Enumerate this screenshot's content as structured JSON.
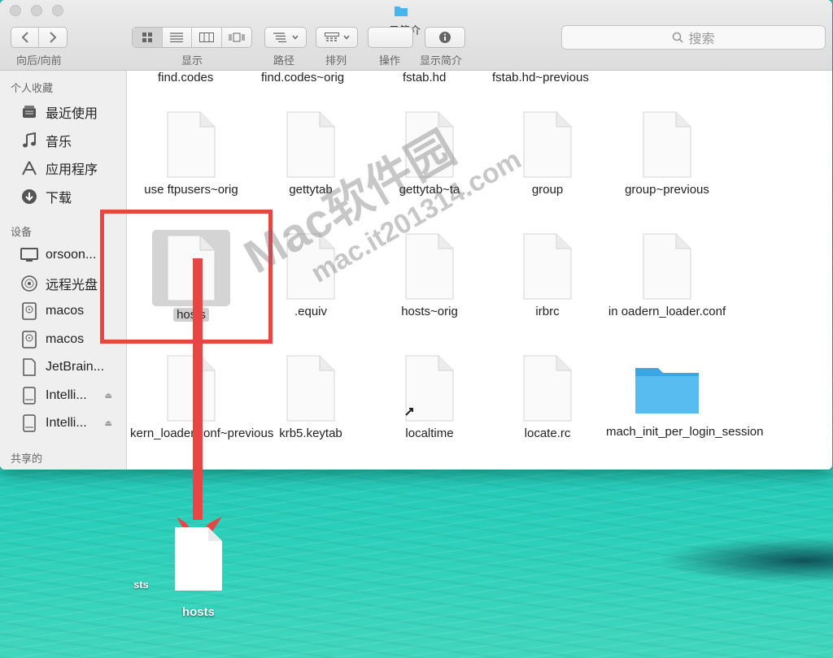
{
  "window": {
    "title": "示简介"
  },
  "toolbar": {
    "back_forward_label": "向后/向前",
    "view_label": "显示",
    "path_label": "路径",
    "arrange_label": "排列",
    "action_label": "操作",
    "info_label": "显示简介",
    "search_placeholder": "搜索"
  },
  "sidebar": {
    "favorites_header": "个人收藏",
    "favorites": [
      {
        "label": "最近使用",
        "icon": "recents-icon"
      },
      {
        "label": "音乐",
        "icon": "music-icon"
      },
      {
        "label": "应用程序",
        "icon": "applications-icon"
      },
      {
        "label": "下载",
        "icon": "downloads-icon"
      }
    ],
    "devices_header": "设备",
    "devices": [
      {
        "label": "orsoon...",
        "icon": "computer-icon"
      },
      {
        "label": "远程光盘",
        "icon": "disc-icon"
      },
      {
        "label": "macos",
        "icon": "disk-icon"
      },
      {
        "label": "macos",
        "icon": "disk-icon"
      },
      {
        "label": "JetBrain...",
        "icon": "document-icon"
      },
      {
        "label": "Intelli...",
        "icon": "external-disk-icon"
      },
      {
        "label": "Intelli...",
        "icon": "external-disk-icon"
      }
    ],
    "shared_header": "共享的"
  },
  "files": {
    "top_row": [
      "find.codes",
      "find.codes~orig",
      "fstab.hd",
      "fstab.hd~previous"
    ],
    "rows": [
      [
        "use  ftpusers~orig",
        "gettytab",
        "gettytab~ta",
        "group",
        "group~previous"
      ],
      [
        "hosts",
        ".equiv",
        "hosts~orig",
        "irbrc",
        "in  oadern_loader.conf"
      ],
      [
        "kern_loader.conf~previous",
        "krb5.keytab",
        "localtime",
        "locate.rc",
        "mach_init_per_login_session"
      ]
    ]
  },
  "desktop": {
    "file_label": "hosts",
    "ghost_label": "sts"
  },
  "watermark": {
    "line1": "Mac软件园",
    "line2": "mac.it201314.com"
  },
  "colors": {
    "highlight": "#e84545",
    "folder": "#49b5ee",
    "selection": "#d4d4d4"
  }
}
